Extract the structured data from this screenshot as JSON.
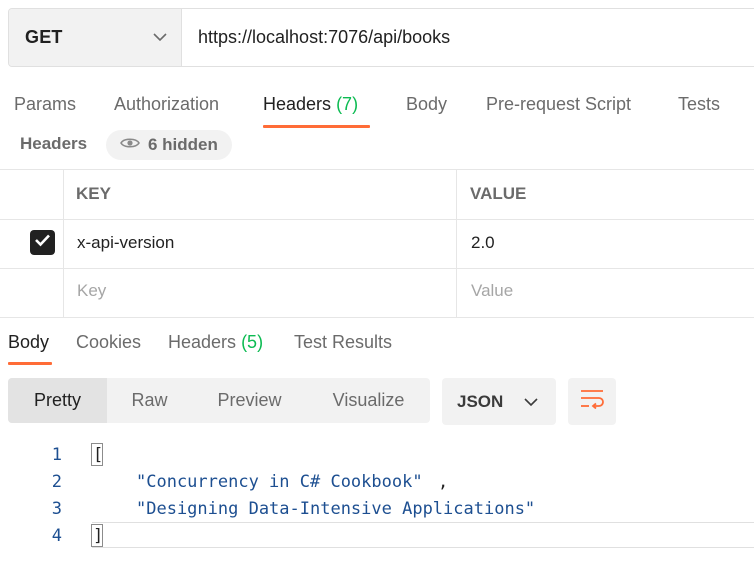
{
  "request": {
    "method": "GET",
    "url": "https://localhost:7076/api/books"
  },
  "request_tabs": [
    {
      "label": "Params"
    },
    {
      "label": "Authorization"
    },
    {
      "label": "Headers",
      "count": "(7)",
      "active": true
    },
    {
      "label": "Body"
    },
    {
      "label": "Pre-request Script"
    },
    {
      "label": "Tests"
    }
  ],
  "headers_section": {
    "title": "Headers",
    "hidden_label": "6 hidden",
    "columns": {
      "key": "KEY",
      "value": "VALUE"
    },
    "rows": [
      {
        "enabled": true,
        "key": "x-api-version",
        "value": "2.0"
      }
    ],
    "new_row": {
      "key_placeholder": "Key",
      "value_placeholder": "Value"
    }
  },
  "response_tabs": [
    {
      "label": "Body",
      "active": true
    },
    {
      "label": "Cookies"
    },
    {
      "label": "Headers",
      "count": "(5)"
    },
    {
      "label": "Test Results"
    }
  ],
  "view_modes": [
    {
      "label": "Pretty",
      "active": true
    },
    {
      "label": "Raw"
    },
    {
      "label": "Preview"
    },
    {
      "label": "Visualize"
    }
  ],
  "format": {
    "selected": "JSON"
  },
  "response_body": {
    "lines": [
      {
        "no": "1",
        "text": "["
      },
      {
        "no": "2",
        "text": "\"Concurrency in C# Cookbook\"",
        "suffix": ","
      },
      {
        "no": "3",
        "text": "\"Designing Data-Intensive Applications\""
      },
      {
        "no": "4",
        "text": "]"
      }
    ]
  },
  "colors": {
    "accent": "#ff6c37",
    "count_green": "#0cbb52",
    "json_string": "#1d4f91"
  },
  "icons": {
    "method_dropdown": "chevron-down-icon",
    "hidden": "eye-icon",
    "checkbox": "checkmark-icon",
    "format_dropdown": "chevron-down-icon",
    "wrap": "wrap-lines-icon"
  }
}
